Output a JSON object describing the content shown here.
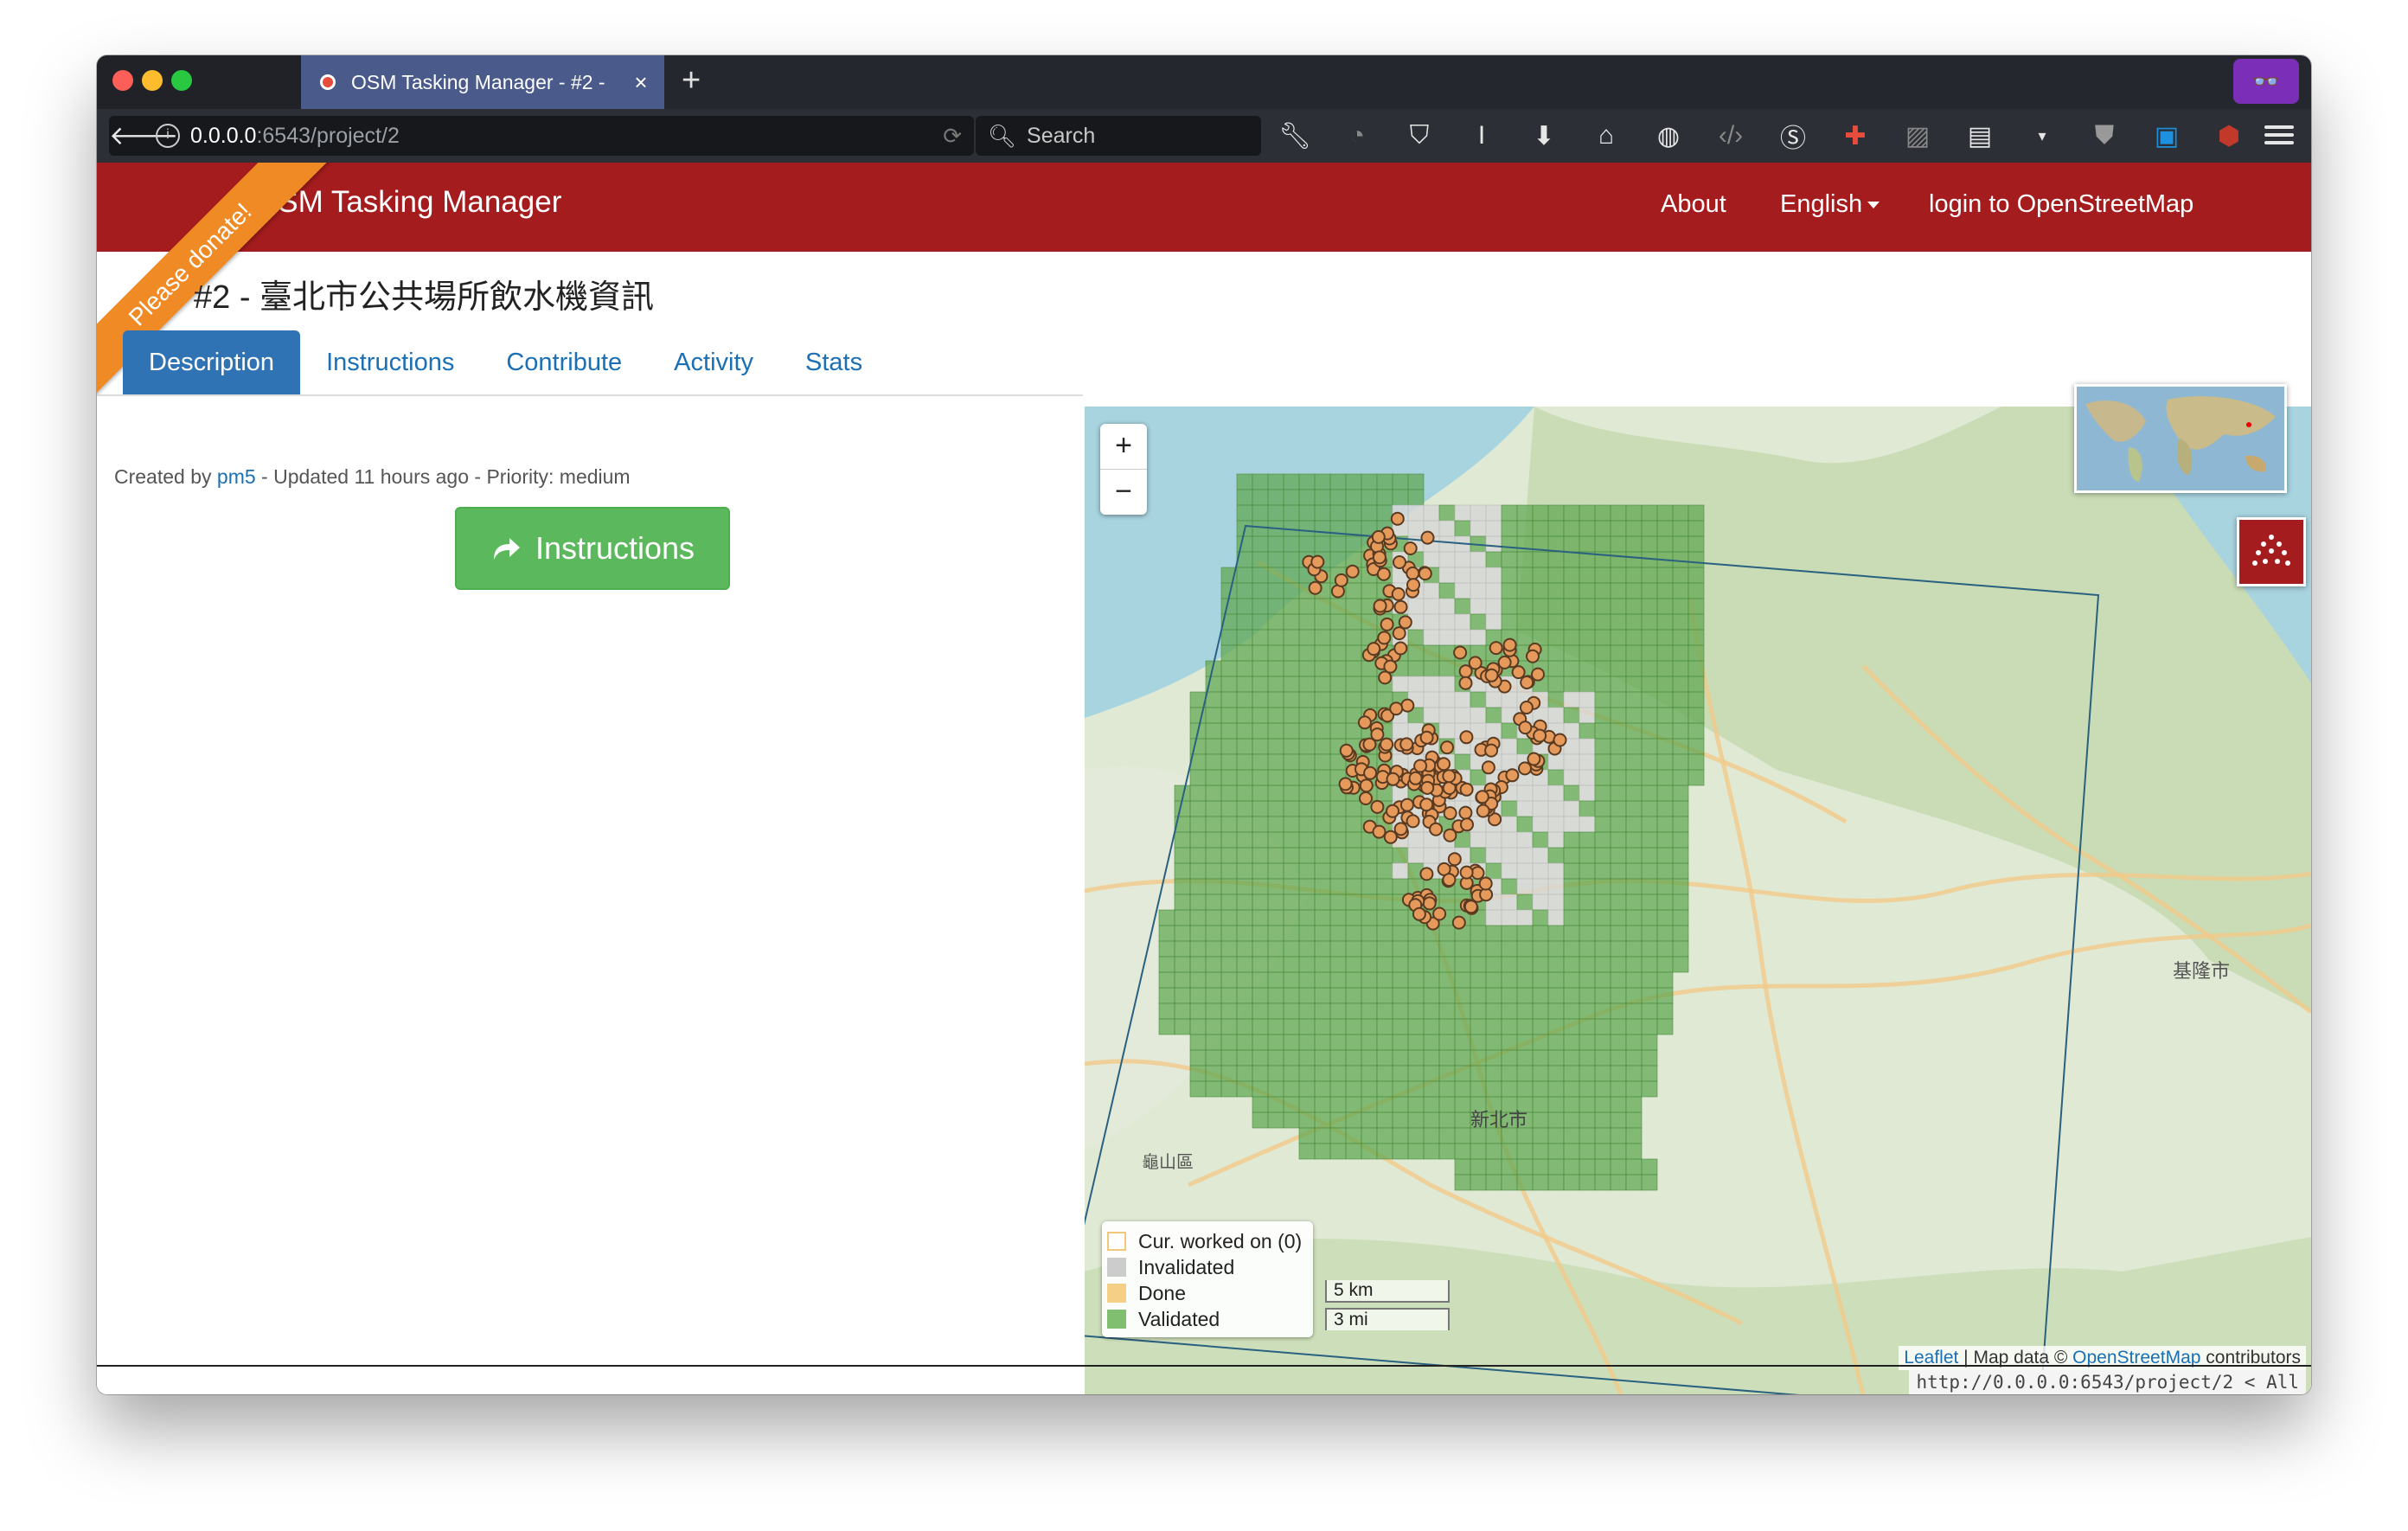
{
  "browser": {
    "tab_title": "OSM Tasking Manager - #2 -",
    "tab_close": "×",
    "new_tab": "+",
    "url_host": "0.0.0.0",
    "url_path": ":6543/project/2",
    "search_placeholder": "Search"
  },
  "header": {
    "brand": "OSM Tasking Manager",
    "nav": {
      "about": "About",
      "language": "English",
      "login": "login to OpenStreetMap"
    },
    "ribbon": "Please donate!"
  },
  "project": {
    "title": "#2 - 臺北市公共場所飲水機資訊",
    "tabs": [
      "Description",
      "Instructions",
      "Contribute",
      "Activity",
      "Stats"
    ],
    "active_tab": "Description",
    "meta": {
      "created_by_label": "Created by",
      "author": "pm5",
      "rest": "- Updated 11 hours ago - Priority: medium"
    },
    "instructions_button": "Instructions"
  },
  "map": {
    "zoom_in": "+",
    "zoom_out": "−",
    "place_labels": [
      "基隆市",
      "新北市",
      "龜山區"
    ],
    "legend": [
      {
        "label": "Cur. worked on (0)",
        "color": "#ffffff",
        "border": "#f3c77a"
      },
      {
        "label": "Invalidated",
        "color": "#cccccc",
        "border": "#cccccc"
      },
      {
        "label": "Done",
        "color": "#f5cf86",
        "border": "#f5cf86"
      },
      {
        "label": "Validated",
        "color": "#7fbf6f",
        "border": "#7fbf6f"
      }
    ],
    "scale_km": "5 km",
    "scale_mi": "3 mi",
    "attribution": {
      "leaflet": "Leaflet",
      "mid": " | Map data © ",
      "osm": "OpenStreetMap",
      "tail": " contributors"
    },
    "colors": {
      "water": "#a8d4e0",
      "land": "#dfe9d4",
      "validated": "#5ea64f",
      "invalidated": "#d6d6d6",
      "point": "#e59a5c"
    }
  },
  "status_url": "http://0.0.0.0:6543/project/2 < All"
}
